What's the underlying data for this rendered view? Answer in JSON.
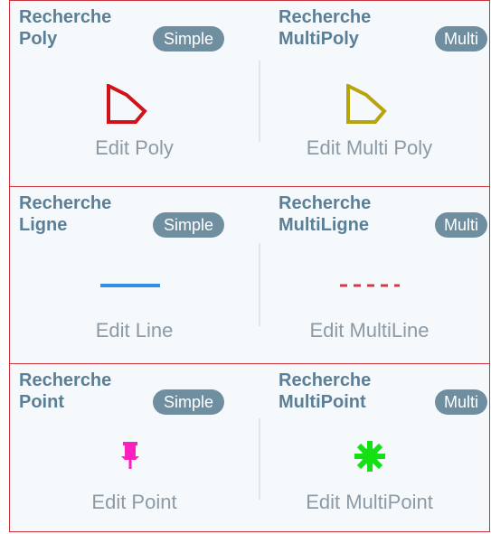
{
  "panels": [
    {
      "left": {
        "title": "Recherche\nPoly",
        "badge": "Simple",
        "edit": "Edit Poly",
        "icon": "polygon-red-icon"
      },
      "right": {
        "title": "Recherche\nMultiPoly",
        "badge": "Multi",
        "edit": "Edit Multi Poly",
        "icon": "polygon-olive-icon"
      }
    },
    {
      "left": {
        "title": "Recherche\nLigne",
        "badge": "Simple",
        "edit": "Edit Line",
        "icon": "line-solid-blue-icon"
      },
      "right": {
        "title": "Recherche\nMultiLigne",
        "badge": "Multi",
        "edit": "Edit MultiLine",
        "icon": "line-dashed-red-icon"
      }
    },
    {
      "left": {
        "title": "Recherche\nPoint",
        "badge": "Simple",
        "edit": "Edit Point",
        "icon": "pushpin-magenta-icon"
      },
      "right": {
        "title": "Recherche\nMultiPoint",
        "badge": "Multi",
        "edit": "Edit MultiPoint",
        "icon": "gear-green-icon"
      }
    }
  ],
  "colors": {
    "panel_border": "#c9343c",
    "title": "#5b7f96",
    "badge_bg": "#6f8fa1",
    "edit_text": "#8c9aa5",
    "poly_simple": "#d2121a",
    "poly_multi": "#b5a40c",
    "line_simple": "#2f8fe9",
    "line_multi": "#d23a48",
    "point_simple": "#ff1fbf",
    "point_multi": "#14e014"
  }
}
